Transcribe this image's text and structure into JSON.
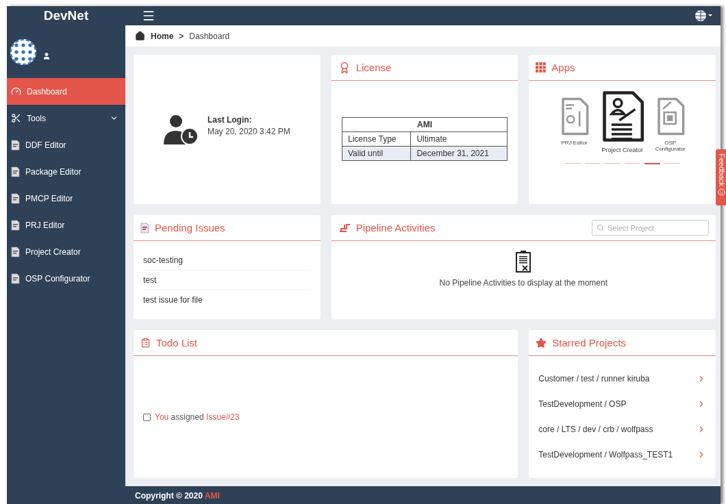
{
  "header": {
    "brand": "DevNet"
  },
  "breadcrumb": {
    "home": "Home",
    "separator": ">",
    "current": "Dashboard"
  },
  "sidebar": {
    "items": [
      {
        "label": "Dashboard",
        "kind": "dashboard",
        "selected": true
      },
      {
        "label": "Tools",
        "kind": "tools",
        "selected": false,
        "expanded": true,
        "children": [
          {
            "label": "DDF Editor",
            "selected": false
          },
          {
            "label": "Package Editor",
            "selected": false
          },
          {
            "label": "PMCP Editor",
            "selected": false
          },
          {
            "label": "PRJ Editor",
            "selected": false
          },
          {
            "label": "Project Creator",
            "selected": false
          },
          {
            "label": "OSP Configurator",
            "selected": false
          }
        ]
      }
    ]
  },
  "last_login": {
    "label": "Last Login:",
    "value": "May 20, 2020 3:42 PM"
  },
  "license": {
    "title": "License",
    "table": {
      "heading": "AMI",
      "rows": [
        [
          "License Type",
          "Ultimate"
        ],
        [
          "Valid until",
          "December 31, 2021"
        ]
      ]
    }
  },
  "apps": {
    "title": "Apps",
    "items": [
      {
        "label": "PRJ Editor",
        "kind": "prj",
        "selected": false
      },
      {
        "label": "Project Creator",
        "kind": "creator",
        "selected": true
      },
      {
        "label": "OSP Configurator",
        "kind": "osp",
        "selected": false
      }
    ],
    "pages": [
      {
        "selected": false
      },
      {
        "selected": false
      },
      {
        "selected": false
      },
      {
        "selected": false
      },
      {
        "selected": true
      },
      {
        "selected": false
      }
    ]
  },
  "pending_issues": {
    "title": "Pending Issues",
    "items": [
      "soc-testing",
      "test",
      "test issue for file"
    ]
  },
  "pipeline": {
    "title": "Pipeline Activities",
    "search": {
      "placeholder": "Select Project"
    },
    "empty_message": "No Pipeline Activities to display at the moment"
  },
  "todo": {
    "title": "Todo List",
    "items": [
      {
        "checked": false,
        "actor": "You",
        "action": "assigned",
        "target": "Issue#23"
      }
    ]
  },
  "starred": {
    "title": "Starred Projects",
    "items": [
      "Customer / test / runner kiruba",
      "TestDevelopment / OSP",
      "core / LTS / dev / crb / wolfpass",
      "TestDevelopment / Wolfpass_TEST1"
    ]
  },
  "feedback": {
    "label": "Feedback"
  },
  "footer": {
    "text": "Copyright © 2020",
    "link": "AMI"
  }
}
